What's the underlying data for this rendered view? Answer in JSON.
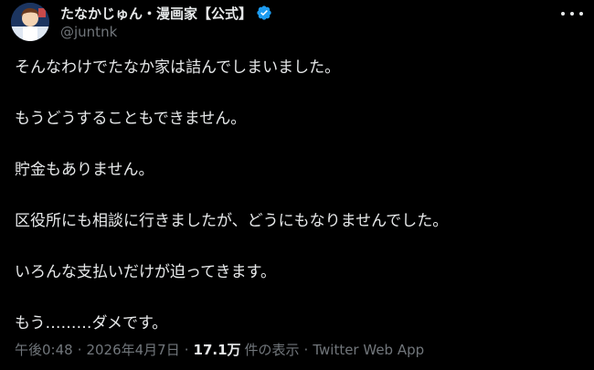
{
  "author": {
    "display_name": "たなかじゅん・漫画家【公式】",
    "handle": "@juntnk"
  },
  "icons": {
    "avatar": "avatar",
    "verified": "verified-badge-icon",
    "more": "more-options-icon",
    "verified_color": "#1d9bf0"
  },
  "tweet": {
    "lines": [
      "そんなわけでたなか家は詰んでしまいました。",
      " もうどうすることもできません。",
      " 貯金もありません。",
      " 区役所にも相談に行きましたが、どうにもなりませんでした。",
      " いろんな支払いだけが迫ってきます。",
      "もう………ダメです。"
    ]
  },
  "meta": {
    "time": "午後0:48",
    "date": "2026年4月7日",
    "views_count": "17.1万",
    "views_label": "件の表示",
    "source": "Twitter Web App",
    "separator": "·"
  }
}
